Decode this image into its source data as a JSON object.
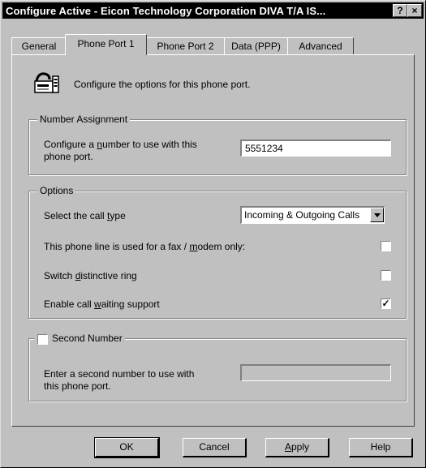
{
  "window": {
    "title": "Configure Active - Eicon Technology Corporation DIVA T/A IS...",
    "help_btn": "?",
    "close_btn": "×"
  },
  "tabs": [
    {
      "label": "General"
    },
    {
      "label": "Phone Port 1",
      "active": true
    },
    {
      "label": "Phone Port 2"
    },
    {
      "label": "Data (PPP)"
    },
    {
      "label": "Advanced"
    }
  ],
  "header": {
    "description": "Configure the options for this phone port.",
    "icon": "phone-fax-icon"
  },
  "number_assignment": {
    "legend": "Number Assignment",
    "label_line1": "Configure a number to use with this",
    "label_line2": "phone port.",
    "value": "5551234"
  },
  "options": {
    "legend": "Options",
    "call_type_label": "Select the call type",
    "call_type_value": "Incoming & Outgoing Calls",
    "fax_modem_label": "This phone line is used for a fax / modem only:",
    "fax_modem_checked": false,
    "distinctive_ring_label": "Switch distinctive ring",
    "distinctive_ring_checked": false,
    "call_waiting_label": "Enable call waiting support",
    "call_waiting_checked": true,
    "check_mark": "✓"
  },
  "second_number": {
    "legend": "Second Number",
    "checked": false,
    "label_line1": "Enter a second number to use with",
    "label_line2": "this phone port.",
    "value": ""
  },
  "buttons": {
    "ok": "OK",
    "cancel": "Cancel",
    "apply": "Apply",
    "help": "Help"
  }
}
